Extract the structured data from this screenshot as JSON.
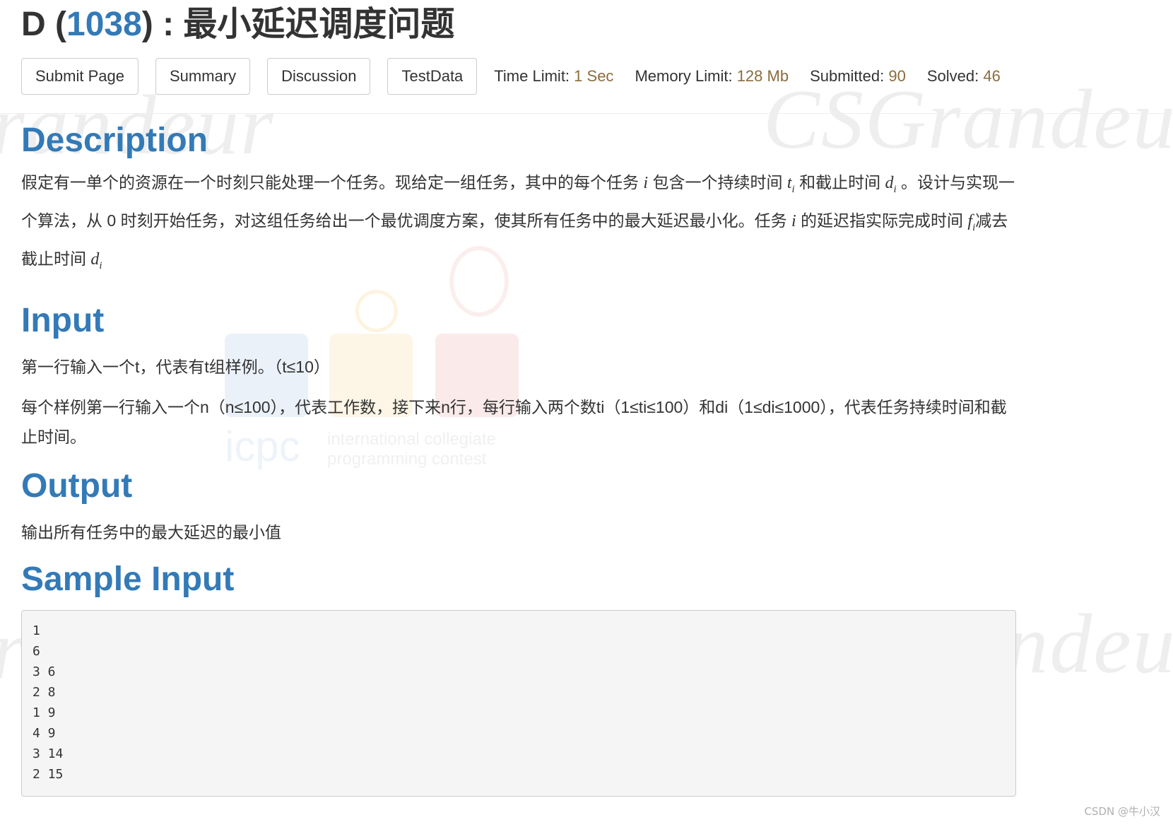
{
  "problem": {
    "letter": "D",
    "id": "1038",
    "title": "最小延迟调度问题"
  },
  "toolbar": {
    "buttons": [
      "Submit Page",
      "Summary",
      "Discussion",
      "TestData"
    ],
    "time_limit_label": "Time Limit:",
    "time_limit_value": "1 Sec",
    "memory_limit_label": "Memory Limit:",
    "memory_limit_value": "128 Mb",
    "submitted_label": "Submitted:",
    "submitted_value": "90",
    "solved_label": "Solved:",
    "solved_value": "46"
  },
  "sections": {
    "description": {
      "heading": "Description",
      "text_1": "假定有一单个的资源在一个时刻只能处理一个任务。现给定一组任务，其中的每个任务 ",
      "text_2": "包含一个持续时间 ",
      "text_3": "和截止时间 ",
      "text_4": "。设计与实现一个算法，从 0 时刻开始任务，对这组任务给出一个最优调度方案，使其所有任务中的最大延迟最小化。任务 ",
      "text_5": "的延迟指实际完成时间 ",
      "text_6": "减去截止时间",
      "var_i": "i",
      "var_t": "t",
      "var_d": "d",
      "var_f": "f",
      "sub_i": "i"
    },
    "input": {
      "heading": "Input",
      "line_1": "第一行输入一个t，代表有t组样例。（t≤10）",
      "line_2": "每个样例第一行输入一个n（n≤100），代表工作数，接下来n行，每行输入两个数ti（1≤ti≤100）和di（1≤di≤1000），代表任务持续时间和截止时间。"
    },
    "output": {
      "heading": "Output",
      "line_1": "输出所有任务中的最大延迟的最小值"
    },
    "sample_input": {
      "heading": "Sample Input",
      "content": "1\n6\n3 6\n2 8\n1 9\n4 9\n3 14\n2 15"
    }
  },
  "watermark": {
    "text": "CSGrandeur",
    "fragment": "randeur",
    "icpc_word": "icpc",
    "icpc_line_1": "international collegiate",
    "icpc_line_2": "programming contest"
  },
  "credit": "CSDN @牛小汉",
  "colors": {
    "link_blue": "#337ab7",
    "value_brown": "#8a6d3b",
    "text": "#333333",
    "sample_bg": "#f5f5f5"
  }
}
